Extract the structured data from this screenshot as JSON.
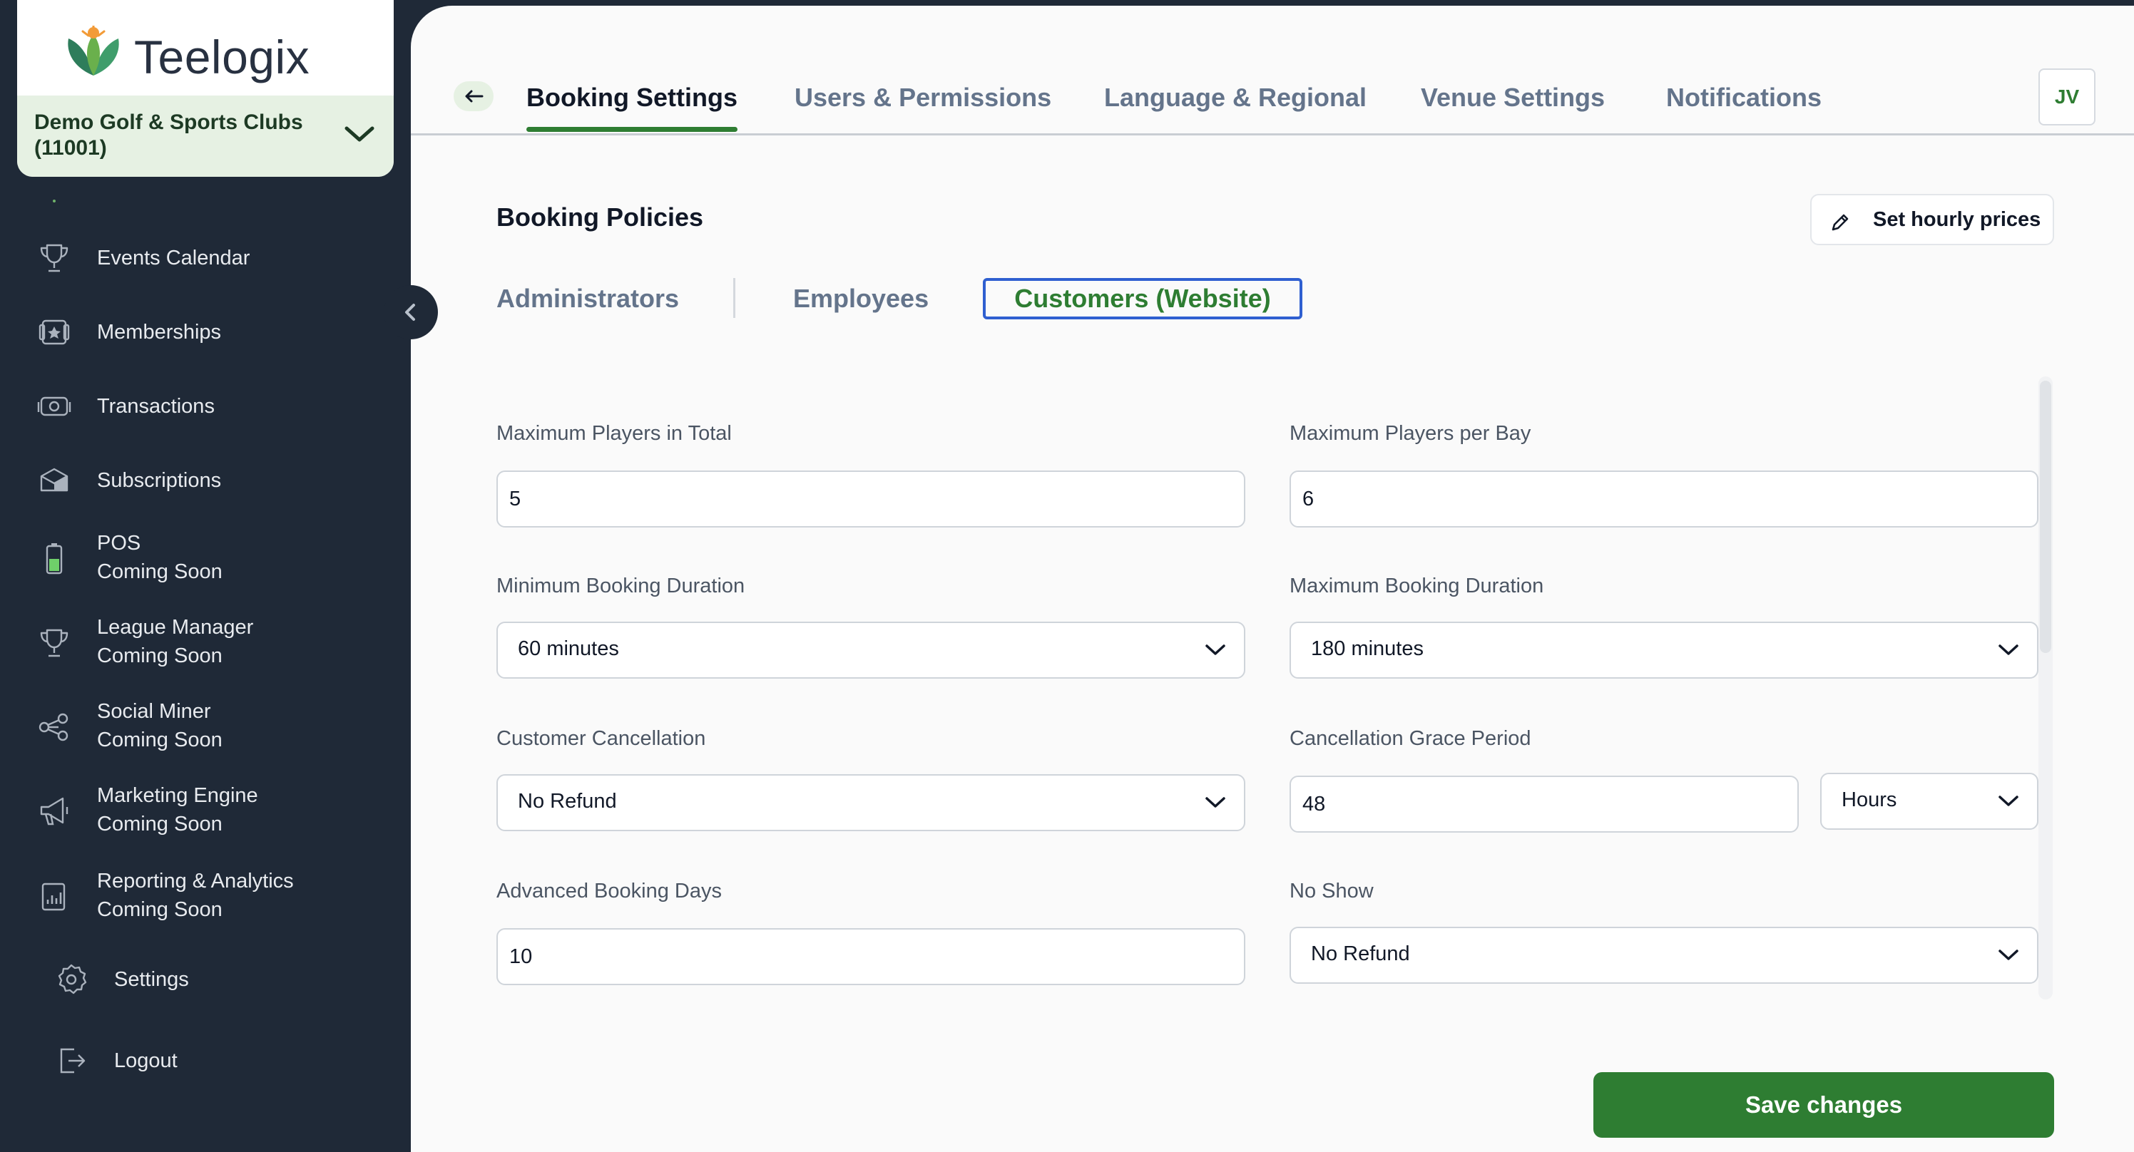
{
  "brand": {
    "name": "Teelogix"
  },
  "org": {
    "name": "Demo Golf & Sports Clubs (11001)"
  },
  "sidebar": {
    "items": [
      {
        "label": "Events Calendar",
        "sub": "",
        "icon": "trophy-icon"
      },
      {
        "label": "Memberships",
        "sub": "",
        "icon": "membership-card-icon"
      },
      {
        "label": "Transactions",
        "sub": "",
        "icon": "money-icon"
      },
      {
        "label": "Subscriptions",
        "sub": "",
        "icon": "subscription-box-icon"
      },
      {
        "label": "POS",
        "sub": "Coming Soon",
        "icon": "battery-icon"
      },
      {
        "label": "League Manager",
        "sub": "Coming Soon",
        "icon": "trophy-icon"
      },
      {
        "label": "Social Miner",
        "sub": "Coming Soon",
        "icon": "share-nodes-icon"
      },
      {
        "label": "Marketing Engine",
        "sub": "Coming Soon",
        "icon": "megaphone-icon"
      },
      {
        "label": "Reporting & Analytics",
        "sub": "Coming Soon",
        "icon": "report-chart-icon"
      },
      {
        "label": "Settings",
        "sub": "",
        "icon": "gear-icon"
      },
      {
        "label": "Logout",
        "sub": "",
        "icon": "logout-icon"
      }
    ]
  },
  "header": {
    "tabs": [
      {
        "label": "Booking Settings",
        "active": true
      },
      {
        "label": "Users & Permissions",
        "active": false
      },
      {
        "label": "Language & Regional",
        "active": false
      },
      {
        "label": "Venue Settings",
        "active": false
      },
      {
        "label": "Notifications",
        "active": false
      }
    ],
    "avatar_initials": "JV"
  },
  "section": {
    "title": "Booking Policies",
    "set_hourly_label": "Set hourly prices"
  },
  "subtabs": [
    {
      "label": "Administrators",
      "active": false
    },
    {
      "label": "Employees",
      "active": false
    },
    {
      "label": "Customers (Website)",
      "active": true
    }
  ],
  "form": {
    "max_players_total": {
      "label": "Maximum Players in Total",
      "value": "5"
    },
    "max_players_bay": {
      "label": "Maximum Players per Bay",
      "value": "6"
    },
    "min_duration": {
      "label": "Minimum Booking Duration",
      "value": "60 minutes"
    },
    "max_duration": {
      "label": "Maximum Booking Duration",
      "value": "180 minutes"
    },
    "customer_cancellation": {
      "label": "Customer Cancellation",
      "value": "No Refund"
    },
    "grace_period": {
      "label": "Cancellation Grace Period",
      "value": "48",
      "unit": "Hours"
    },
    "advanced_days": {
      "label": "Advanced Booking Days",
      "value": "10"
    },
    "no_show": {
      "label": "No Show",
      "value": "No Refund"
    }
  },
  "actions": {
    "save_label": "Save changes"
  },
  "colors": {
    "accent": "#2e7d32",
    "sidebar_bg": "#1f2937",
    "focus_ring": "#2f5fd0",
    "org_bg": "#e6f1e3"
  }
}
